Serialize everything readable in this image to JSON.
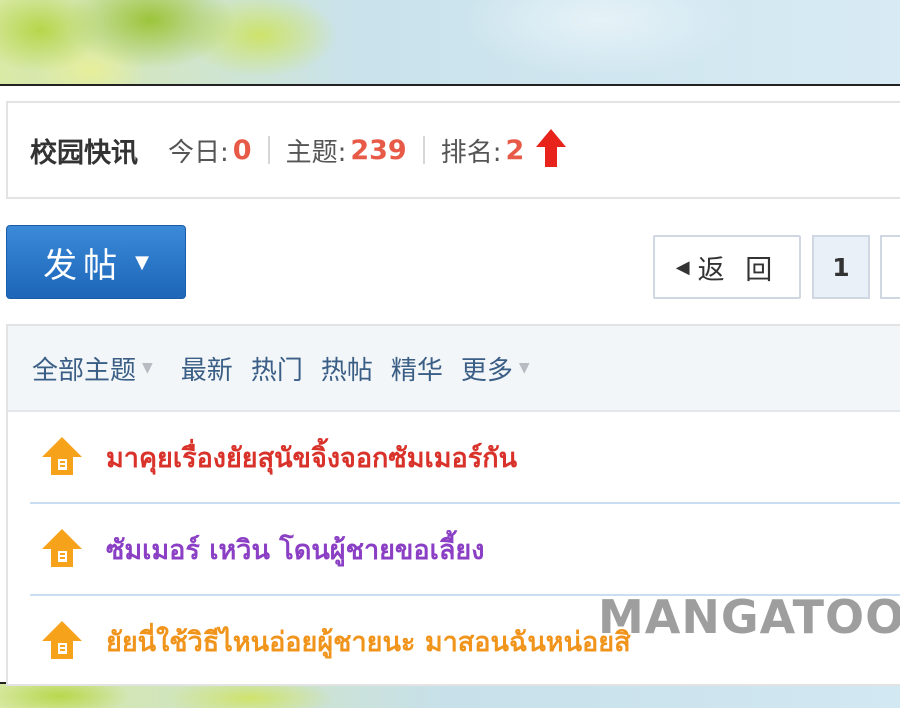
{
  "forum": {
    "name": "校园快讯",
    "stats": [
      {
        "label": "今日:",
        "value": "0"
      },
      {
        "label": "主题:",
        "value": "239"
      },
      {
        "label": "排名:",
        "value": "2"
      }
    ]
  },
  "toolbar": {
    "post_label": "发帖",
    "back_label": "返 回",
    "current_page": "1"
  },
  "filters": [
    {
      "label": "全部主题",
      "dropdown": true
    },
    {
      "label": "最新",
      "dropdown": false
    },
    {
      "label": "热门",
      "dropdown": false
    },
    {
      "label": "热帖",
      "dropdown": false
    },
    {
      "label": "精华",
      "dropdown": false
    },
    {
      "label": "更多",
      "dropdown": true
    }
  ],
  "threads": [
    {
      "title": "มาคุยเรื่องยัยสุนัขจิ้งจอกซัมเมอร์กัน",
      "color": "#d9322a",
      "icon": "up-arrow-badge-icon"
    },
    {
      "title": "ซัมเมอร์ เหวิน โดนผู้ชายขอเลี้ยง",
      "color": "#8a3fc4",
      "icon": "up-arrow-badge-icon"
    },
    {
      "title": "ยัยนี่ใช้วิธีไหนอ่อยผู้ชายนะ มาสอนฉันหน่อยสิ",
      "color": "#f0941c",
      "icon": "up-arrow-badge-icon"
    }
  ],
  "colors": {
    "accent_blue": "#1d66b8",
    "stat_red": "#e85a48",
    "icon_orange": "#f7a21b"
  },
  "watermark": "MANGATOON"
}
